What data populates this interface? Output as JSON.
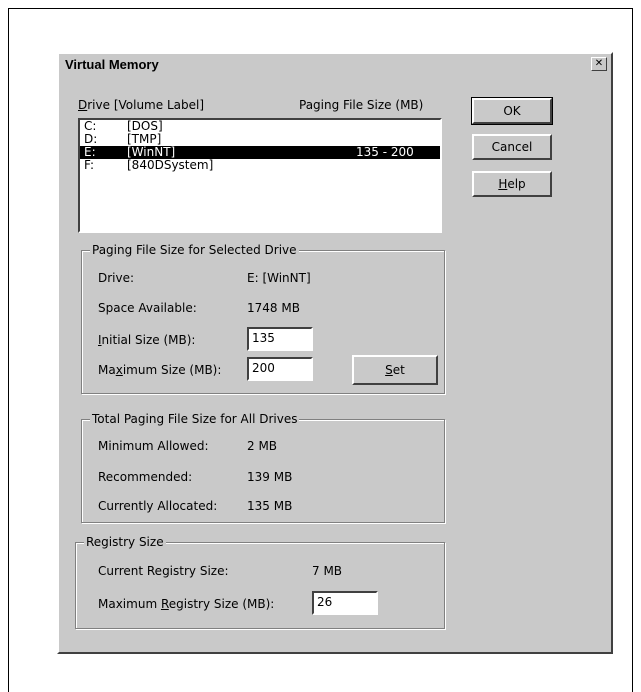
{
  "dialog": {
    "title": "Virtual Memory",
    "close_symbol": "✕"
  },
  "drives": {
    "header_drive_letter": "D",
    "header_drive_rest": "rive  [Volume Label]",
    "header_size": "Paging File Size (MB)",
    "items": [
      {
        "letter": "C:",
        "label": "[DOS]",
        "size": ""
      },
      {
        "letter": "D:",
        "label": "[TMP]",
        "size": ""
      },
      {
        "letter": "E:",
        "label": "[WinNT]",
        "size": "135 - 200",
        "selected": true
      },
      {
        "letter": "F:",
        "label": "[840DSystem]",
        "size": ""
      }
    ]
  },
  "buttons": {
    "ok": "OK",
    "cancel": "Cancel",
    "help_u": "H",
    "help_rest": "elp",
    "set_u": "S",
    "set_rest": "et"
  },
  "selected_drive": {
    "legend": "Paging File Size for Selected Drive",
    "drive_label": "Drive:",
    "drive_value": "E:  [WinNT]",
    "space_label": "Space Available:",
    "space_value": "1748 MB",
    "initial_u": "I",
    "initial_rest": "nitial Size (MB):",
    "initial_value": "135",
    "max_pre": "Ma",
    "max_u": "x",
    "max_rest": "imum Size (MB):",
    "max_value": "200"
  },
  "totals": {
    "legend": "Total Paging File Size for All Drives",
    "min_label": "Minimum Allowed:",
    "min_value": "2 MB",
    "rec_label": "Recommended:",
    "rec_value": "139 MB",
    "alloc_label": "Currently Allocated:",
    "alloc_value": "135 MB"
  },
  "registry": {
    "legend": "Registry Size",
    "current_label": "Current Registry Size:",
    "current_value": "7 MB",
    "max_pre": "Maximum ",
    "max_u": "R",
    "max_rest": "egistry Size (MB):",
    "max_value": "26"
  }
}
